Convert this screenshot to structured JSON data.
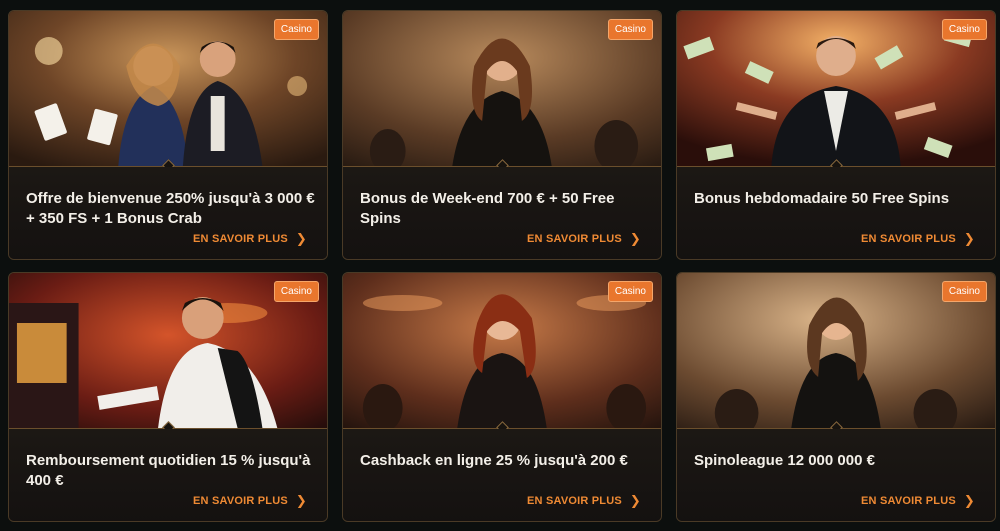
{
  "cards": [
    {
      "badge": "Casino",
      "title": "Offre de bienvenue 250% jusqu'à 3 000 € + 350 FS + 1 Bonus Crab",
      "link": "EN SAVOIR PLUS"
    },
    {
      "badge": "Casino",
      "title": "Bonus de Week-end 700 € + 50 Free Spins",
      "link": "EN SAVOIR PLUS"
    },
    {
      "badge": "Casino",
      "title": "Bonus hebdomadaire 50 Free Spins",
      "link": "EN SAVOIR PLUS"
    },
    {
      "badge": "Casino",
      "title": "Remboursement quotidien 15 % jusqu'à 400 €",
      "link": "EN SAVOIR PLUS"
    },
    {
      "badge": "Casino",
      "title": "Cashback en ligne 25 % jusqu'à 200 €",
      "link": "EN SAVOIR PLUS"
    },
    {
      "badge": "Casino",
      "title": "Spinoleague 12 000 000 €",
      "link": "EN SAVOIR PLUS"
    }
  ],
  "icons": {
    "link_chevron": "chevron-right-icon"
  },
  "colors": {
    "accent": "#ef8a34",
    "badge": "#e9762d",
    "card_bg": "#17130f",
    "page_bg": "#0c0f0e"
  }
}
